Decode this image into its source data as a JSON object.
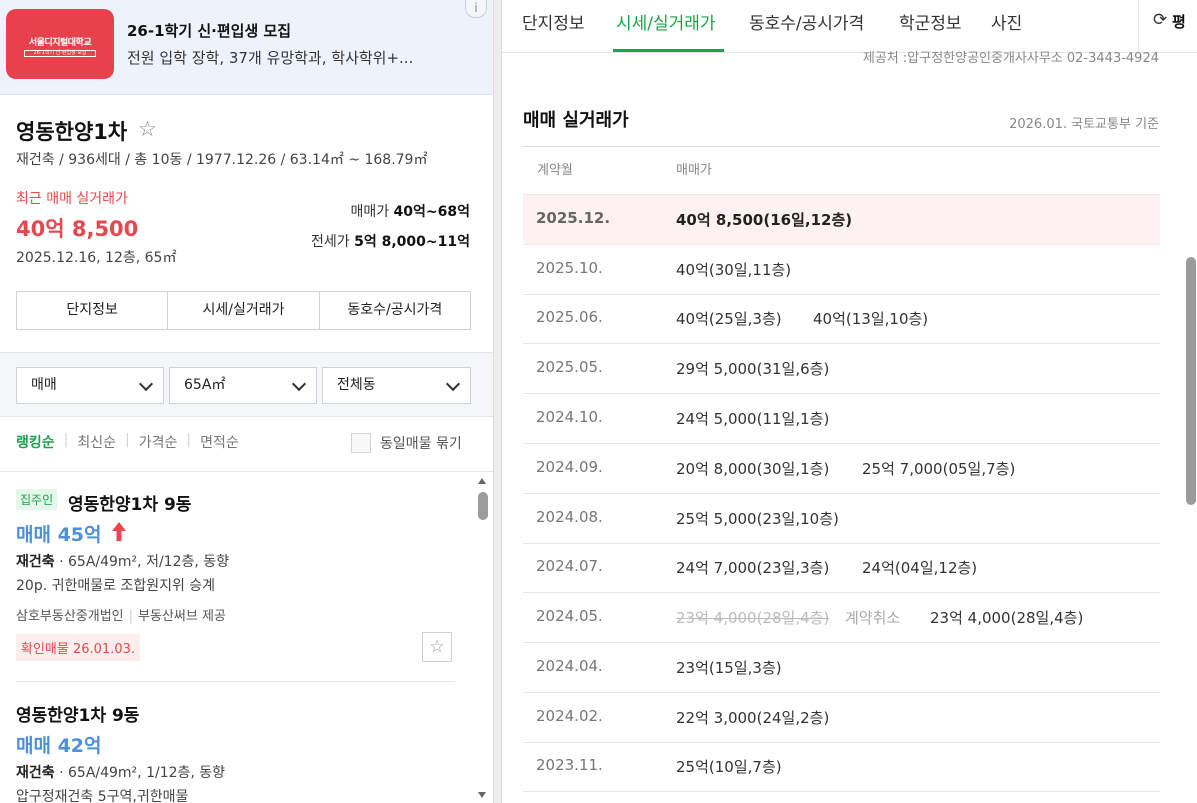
{
  "ad": {
    "logo_text": "서울디지털대학교",
    "logo_sub": "26-1학기 신·편입생 모집",
    "title": "26-1학기 신·편입생 모집",
    "description": "전원 입학 장학, 37개 유망학과, 학사학위+...",
    "info_icon": "i"
  },
  "complex": {
    "name": "영동한양1차",
    "meta": "재건축 / 936세대 / 총 10동 / 1977.12.26 / 63.14㎡ ~ 168.79㎡",
    "recent_label": "최근 매매 실거래가",
    "recent_price": "40억 8,500",
    "recent_detail": "2025.12.16, 12층, 65㎡",
    "sale_label": "매매가",
    "sale_value": "40억~68억",
    "lease_label": "전세가",
    "lease_value": "5억 8,000~11억"
  },
  "subtabs": [
    "단지정보",
    "시세/실거래가",
    "동호수/공시가격"
  ],
  "filters": {
    "trade_type": "매매",
    "area": "65A㎡",
    "dong": "전체동"
  },
  "sort": {
    "options": [
      "랭킹순",
      "최신순",
      "가격순",
      "면적순"
    ],
    "same_listing_label": "동일매물 묶기"
  },
  "listings": [
    {
      "badge": "집주인",
      "title": "영동한양1차 9동",
      "price": "매매 45억",
      "type": "재건축",
      "spec": "65A/49m², 저/12층, 동향",
      "desc": "20p. 귀한매물로 조합원지위 승계",
      "agency": "삼호부동산중개법인",
      "provider": "부동산써브 제공",
      "verified": "확인매물 26.01.03.",
      "fav_icon": "☆"
    },
    {
      "title": "영동한양1차 9동",
      "price": "매매 42억",
      "type": "재건축",
      "spec": "65A/49m², 1/12층, 동향",
      "desc": "압구정재건축 5구역,귀한매물"
    }
  ],
  "right": {
    "tabs": [
      "단지정보",
      "시세/실거래가",
      "동호수/공시가격",
      "학군정보",
      "사진"
    ],
    "refresh_label": "평",
    "provider": "제공처 :압구정한양공인중개사사무소 02-3443-4924",
    "section_title": "매매 실거래가",
    "basis": "2026.01. 국토교통부 기준",
    "col_month": "계약월",
    "col_price": "매매가",
    "rows": [
      {
        "month": "2025.12.",
        "deals": [
          "40억 8,500(16일,12층)"
        ]
      },
      {
        "month": "2025.10.",
        "deals": [
          "40억(30일,11층)"
        ]
      },
      {
        "month": "2025.06.",
        "deals": [
          "40억(25일,3층)",
          "40억(13일,10층)"
        ]
      },
      {
        "month": "2025.05.",
        "deals": [
          "29억 5,000(31일,6층)"
        ]
      },
      {
        "month": "2024.10.",
        "deals": [
          "24억 5,000(11일,1층)"
        ]
      },
      {
        "month": "2024.09.",
        "deals": [
          "20억 8,000(30일,1층)",
          "25억 7,000(05일,7층)"
        ]
      },
      {
        "month": "2024.08.",
        "deals": [
          "25억 5,000(23일,10층)"
        ]
      },
      {
        "month": "2024.07.",
        "deals": [
          "24억 7,000(23일,3층)",
          "24억(04일,12층)"
        ]
      },
      {
        "month": "2024.05.",
        "cancelled": "23억 4,000(28일,4층)",
        "cancel_label": "계약취소",
        "deals": [
          "23억 4,000(28일,4층)"
        ]
      },
      {
        "month": "2024.04.",
        "deals": [
          "23억(15일,3층)"
        ]
      },
      {
        "month": "2024.02.",
        "deals": [
          "22억 3,000(24일,2층)"
        ]
      },
      {
        "month": "2023.11.",
        "deals": [
          "25억(10일,7층)"
        ]
      }
    ]
  },
  "colors": {
    "accent_green": "#1aa34a",
    "price_red": "#e8474e",
    "listing_blue": "#4e8fdb"
  }
}
